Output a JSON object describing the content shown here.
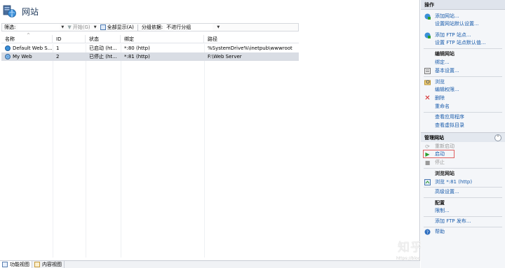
{
  "page": {
    "title": "网站"
  },
  "toolbar": {
    "filter_label": "筛选:",
    "start_label": "开始(G)",
    "show_all_label": "全部显示(A)",
    "group_by_label": "分组依据:",
    "group_by_value": "不进行分组"
  },
  "grid": {
    "columns": [
      "名称",
      "ID",
      "状态",
      "绑定",
      "路径"
    ],
    "rows": [
      {
        "name": "Default Web S...",
        "id": "1",
        "status": "已启动 (ht...",
        "binding": "*:80 (http)",
        "path": "%SystemDrive%\\inetpub\\wwwroot"
      },
      {
        "name": "My Web",
        "id": "2",
        "status": "已停止 (ht...",
        "binding": "*:81 (http)",
        "path": "F:\\Web Server"
      }
    ]
  },
  "bottom_tabs": {
    "features": "功能视图",
    "content": "内容视图"
  },
  "actions": {
    "header": "操作",
    "add_site": "添加网站...",
    "site_defaults": "设置网站默认设置...",
    "add_ftp": "添加 FTP 站点...",
    "ftp_defaults": "设置 FTP 站点默认值...",
    "edit_site_heading": "编辑网站",
    "bindings": "绑定...",
    "basic_settings": "基本设置...",
    "explore": "浏览",
    "edit_permissions": "编辑权限...",
    "remove": "删除",
    "rename": "重命名",
    "view_apps": "查看应用程序",
    "view_vdirs": "查看虚拟目录",
    "manage_site_heading": "管理网站",
    "restart": "重新启动",
    "start": "启动",
    "stop": "停止",
    "browse_heading": "浏览网站",
    "browse_81": "浏览 *:81 (http)",
    "advanced": "高级设置...",
    "config_heading": "配置",
    "limits": "限制...",
    "add_ftp_publish": "添加 FTP 发布...",
    "help": "帮助"
  },
  "watermark": {
    "text": "知乎 @翼之翼",
    "url": "https://blog.csdn.net/qq_41380789"
  },
  "colors": {
    "link": "#1a5cab",
    "selected_row": "#d9dde4",
    "highlight": "#e06060",
    "start_green": "#2e9e2e",
    "remove_red": "#d42020"
  }
}
